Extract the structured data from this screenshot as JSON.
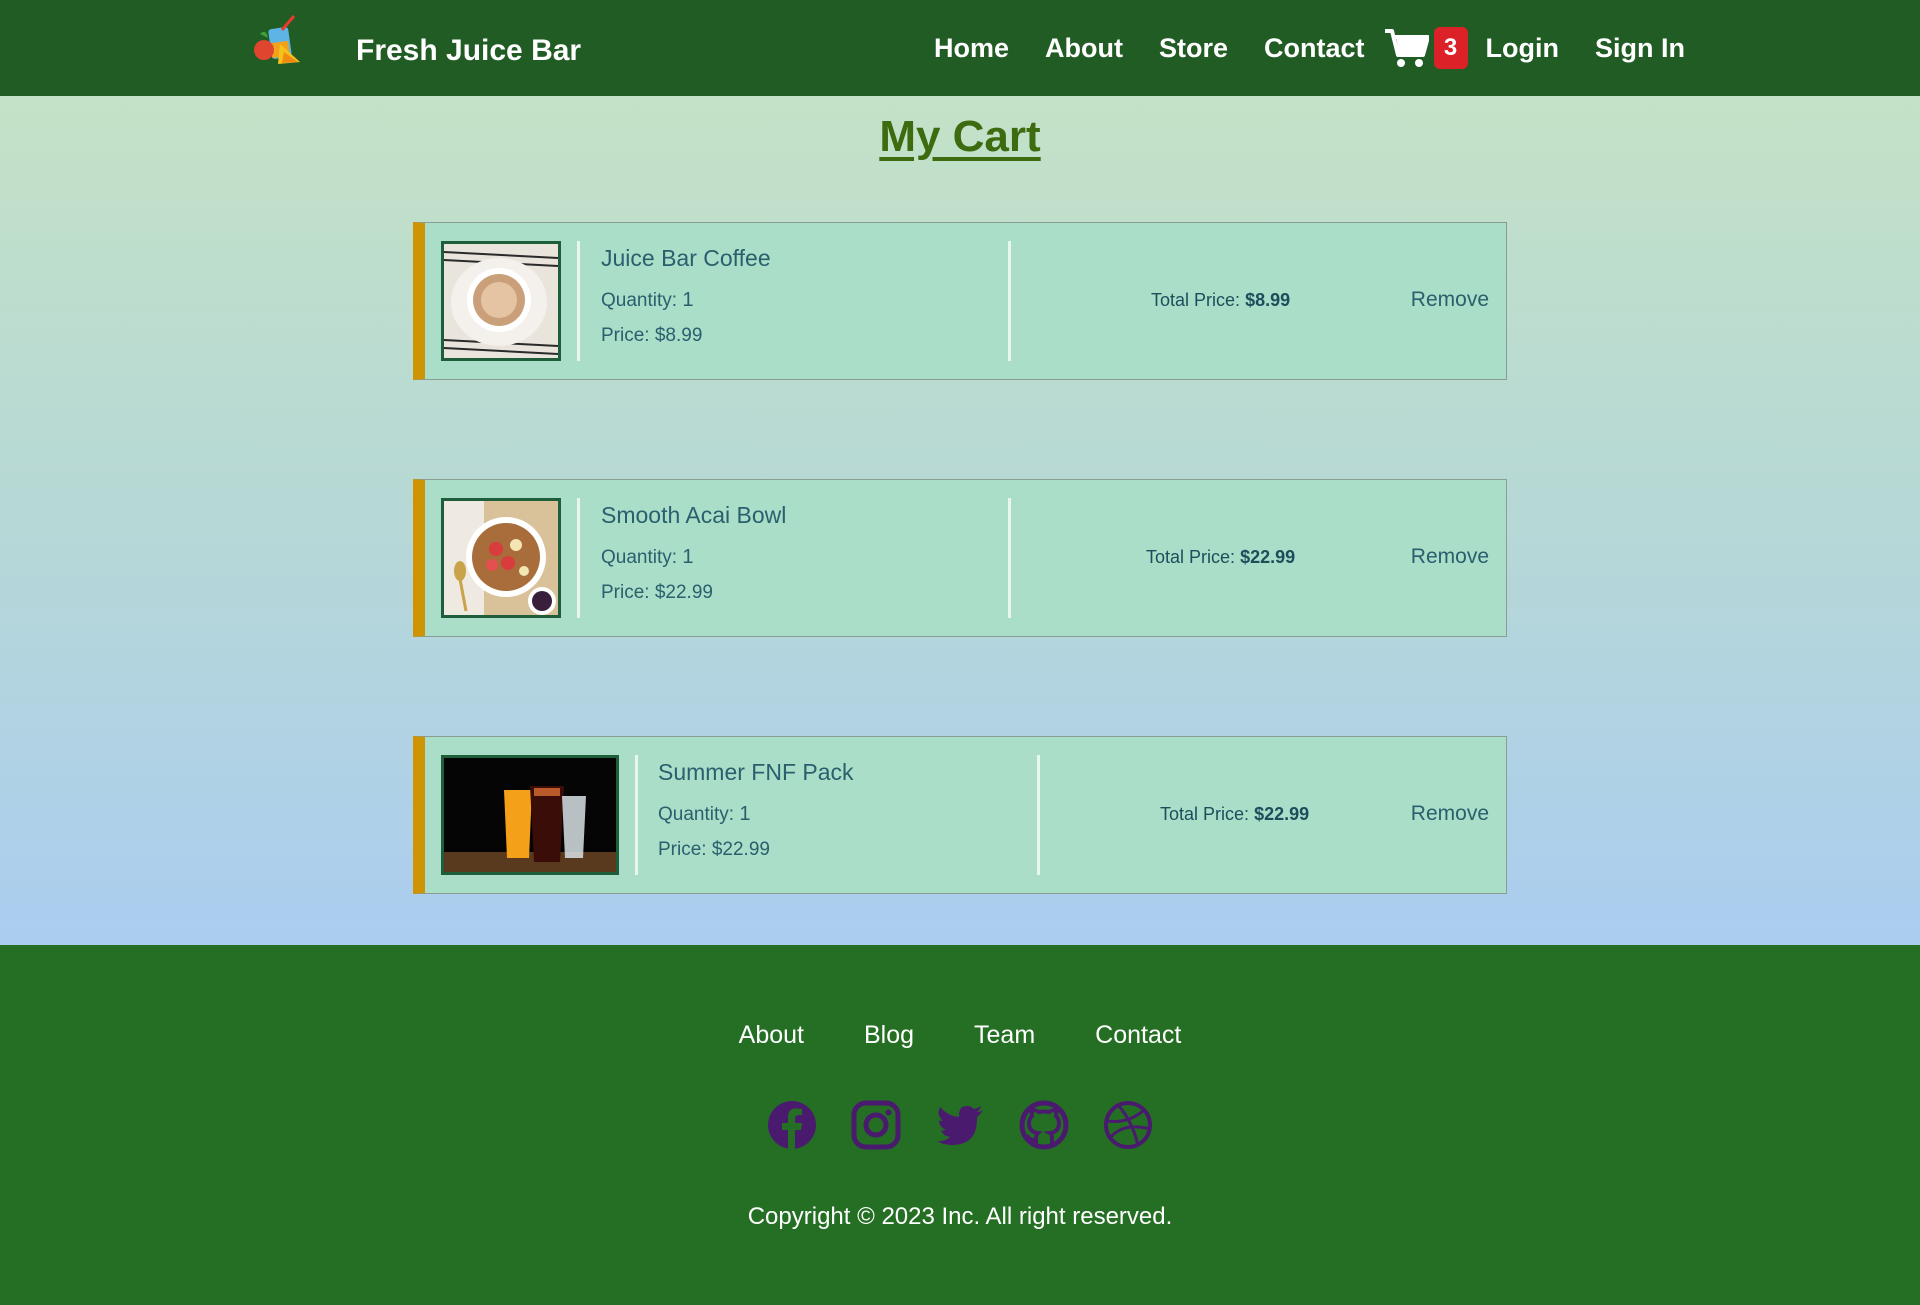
{
  "nav": {
    "brand": "Fresh Juice Bar",
    "links": [
      "Home",
      "About",
      "Store",
      "Contact"
    ],
    "cart_count": "3",
    "login": "Login",
    "signin": "Sign In"
  },
  "page_title": "My Cart",
  "cart": {
    "items": [
      {
        "name": "Juice Bar Coffee",
        "quantity_label": "Quantity:",
        "quantity": "1",
        "price_label": "Price: $8.99",
        "total_label": "Total Price:",
        "total": "$8.99",
        "remove": "Remove"
      },
      {
        "name": "Smooth Acai Bowl",
        "quantity_label": "Quantity:",
        "quantity": "1",
        "price_label": "Price: $22.99",
        "total_label": "Total Price:",
        "total": "$22.99",
        "remove": "Remove"
      },
      {
        "name": "Summer FNF Pack",
        "quantity_label": "Quantity:",
        "quantity": "1",
        "price_label": "Price: $22.99",
        "total_label": "Total Price:",
        "total": "$22.99",
        "remove": "Remove"
      }
    ]
  },
  "footer": {
    "links": [
      "About",
      "Blog",
      "Team",
      "Contact"
    ],
    "social": [
      "facebook-icon",
      "instagram-icon",
      "twitter-icon",
      "github-icon",
      "dribbble-icon"
    ],
    "copyright": "Copyright © 2023 Inc. All right reserved."
  },
  "colors": {
    "nav_bg": "#225c25",
    "footer_bg": "#256f25",
    "item_bg": "#aadec8",
    "item_accent": "#cf9404",
    "badge": "#dc2128",
    "title": "#3c6b10",
    "social": "#4a1a6e"
  }
}
